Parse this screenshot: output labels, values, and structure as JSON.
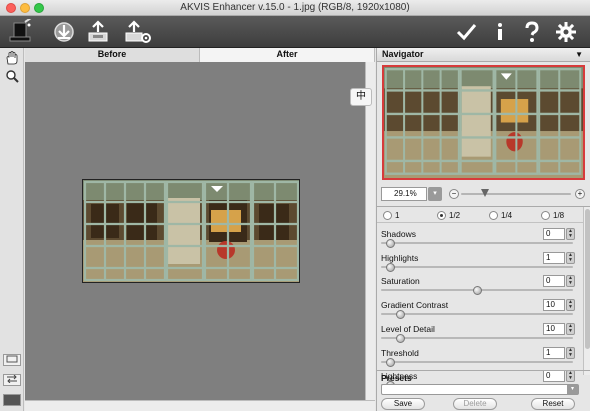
{
  "window": {
    "title": "AKVIS Enhancer v.15.0 - 1.jpg (RGB/8, 1920x1080)"
  },
  "toolbar": {
    "left_icons": [
      "top-hat-logo-icon",
      "open-image-icon",
      "save-image-icon",
      "batch-process-icon"
    ],
    "right_icons": [
      "apply-check-icon",
      "info-icon",
      "help-icon",
      "settings-gear-icon"
    ]
  },
  "tabs": {
    "before": "Before",
    "after": "After"
  },
  "canvas": {
    "overlay_button": "中"
  },
  "navigator": {
    "title": "Navigator",
    "zoom_value": "29.1%",
    "zoom_minus": "−",
    "zoom_plus": "+"
  },
  "scale_options": [
    {
      "label": "1",
      "selected": false
    },
    {
      "label": "1/2",
      "selected": true
    },
    {
      "label": "1/4",
      "selected": false
    },
    {
      "label": "1/8",
      "selected": false
    }
  ],
  "params": [
    {
      "label": "Shadows",
      "value": "0"
    },
    {
      "label": "Highlights",
      "value": "1"
    },
    {
      "label": "Saturation",
      "value": "0"
    },
    {
      "label": "Gradient Contrast",
      "value": "10"
    },
    {
      "label": "Level of Detail",
      "value": "10"
    },
    {
      "label": "Threshold",
      "value": "1"
    },
    {
      "label": "Lightness",
      "value": "0"
    }
  ],
  "param_levels": [
    0.03,
    0.03,
    0.5,
    0.08,
    0.08,
    0.03,
    0.03
  ],
  "presets": {
    "title": "Presets",
    "save": "Save",
    "delete": "Delete",
    "reset": "Reset"
  },
  "colors": {
    "toolbar": "#4a4a4a",
    "canvas": "#7f7f7f",
    "nav_frame": "#d63b3b"
  }
}
